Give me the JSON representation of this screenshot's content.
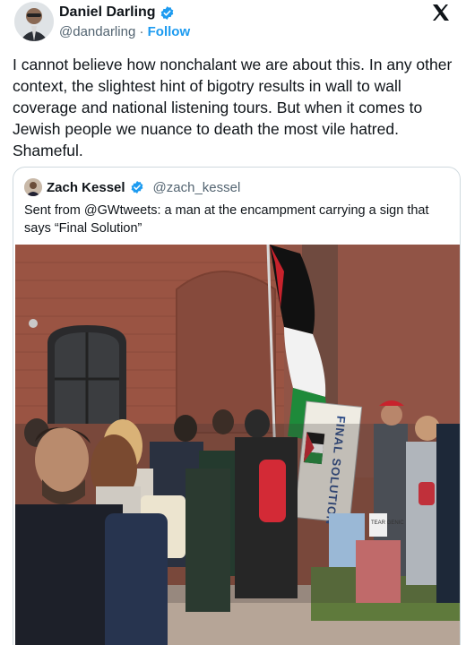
{
  "author": {
    "name": "Daniel Darling",
    "handle": "@dandarling",
    "separator": "·",
    "follow_label": "Follow"
  },
  "tweet": {
    "text": "I cannot believe how nonchalant we are about this. In any other context, the slightest hint of bigotry results in wall to wall coverage and national listening tours. But when it comes to Jewish people we nuance to death the most vile hatred. Shameful."
  },
  "quote": {
    "name": "Zach Kessel",
    "handle": "@zach_kessel",
    "text": "Sent from @GWtweets: a man at the encampment carrying a sign that says “Final Solution”",
    "photo": {
      "sign_text": "FINAL SOLUTION",
      "small_sign_text": "TEAR GENIC"
    }
  },
  "icons": [
    "verified-badge-icon",
    "x-logo-icon"
  ],
  "colors": {
    "accent": "#1d9bf0",
    "text_primary": "#0f1419",
    "text_secondary": "#536471",
    "border": "#cfd9de"
  }
}
